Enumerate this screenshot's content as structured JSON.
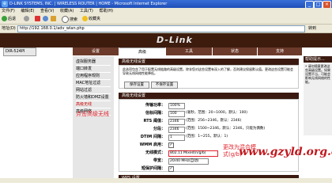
{
  "window": {
    "title": "D-LINK SYSTEMS, INC. | WIRELESS ROUTER | HOME - Microsoft Internet Explorer"
  },
  "menubar": {
    "items": [
      "文件(F)",
      "编辑(E)",
      "查看(V)",
      "收藏(A)",
      "工具(T)",
      "帮助(H)"
    ]
  },
  "toolbar": {
    "back": "后退",
    "forward": "",
    "search": "搜索",
    "favorites": "收藏夹"
  },
  "address": {
    "label": "地址(D)",
    "url": "http://192.168.0.1/adv_wlan.php",
    "go": "转到"
  },
  "brand": {
    "logo": "D-Link",
    "model": "DIR-524PI"
  },
  "nav": {
    "tabs": [
      "设置",
      "高级",
      "工具",
      "状态",
      "支持"
    ]
  },
  "sidebar": {
    "items": [
      "虚拟服务器",
      "端口转发",
      "应用程序规则",
      "MAC地址过滤",
      "网站过滤",
      "防火墙和DMZ设置",
      "高级无线",
      "高级网络"
    ],
    "annotation": "点击高级无线"
  },
  "main": {
    "adv_wireless": {
      "header": "高级无线设置",
      "description": "此选项包含了用于配置无线链路的高级设置。除非您对这些设置有深入的了解，否则建议保留默认值。更改这些设置可能会导致无线网络性能降低。",
      "save": "保存设置",
      "dont_save": "不保存设置"
    },
    "adv_settings": {
      "header": "高级无线设置",
      "rows": [
        {
          "label": "传输功率：",
          "value": "100%",
          "hint": ""
        },
        {
          "label": "信标间隔：",
          "value": "100",
          "hint": "(毫秒，范围：20~1000，默认：100)"
        },
        {
          "label": "RTS 阈值：",
          "value": "2346",
          "hint": "(范围：256~2346，默认：2346)"
        },
        {
          "label": "分段：",
          "value": "2346",
          "hint": "(范围：1500~2346，默认：2346，只能为偶数)"
        },
        {
          "label": "DTIM 间隔：",
          "value": "1",
          "hint": "(范围：1~255，默认：1)"
        },
        {
          "label": "WMM 启用：",
          "value": "",
          "hint": ""
        },
        {
          "label": "无线模式：",
          "value": "802.11 Mixed(n/g/b)",
          "hint": ""
        },
        {
          "label": "带宽：",
          "value": "20/40 MHz(自动)",
          "hint": ""
        },
        {
          "label": "短保护间隔：",
          "value": "",
          "hint": ""
        }
      ],
      "annotation": "更改为混合模式(g/b)",
      "watermark": "www.gzyld.org.cn"
    },
    "wps": {
      "header": "WPS 设置"
    }
  },
  "help": {
    "header": "帮助提示...",
    "text": "• 请勿随意更改这些高级设置。如果设置不当，可能会影响无线网络的性能。"
  }
}
